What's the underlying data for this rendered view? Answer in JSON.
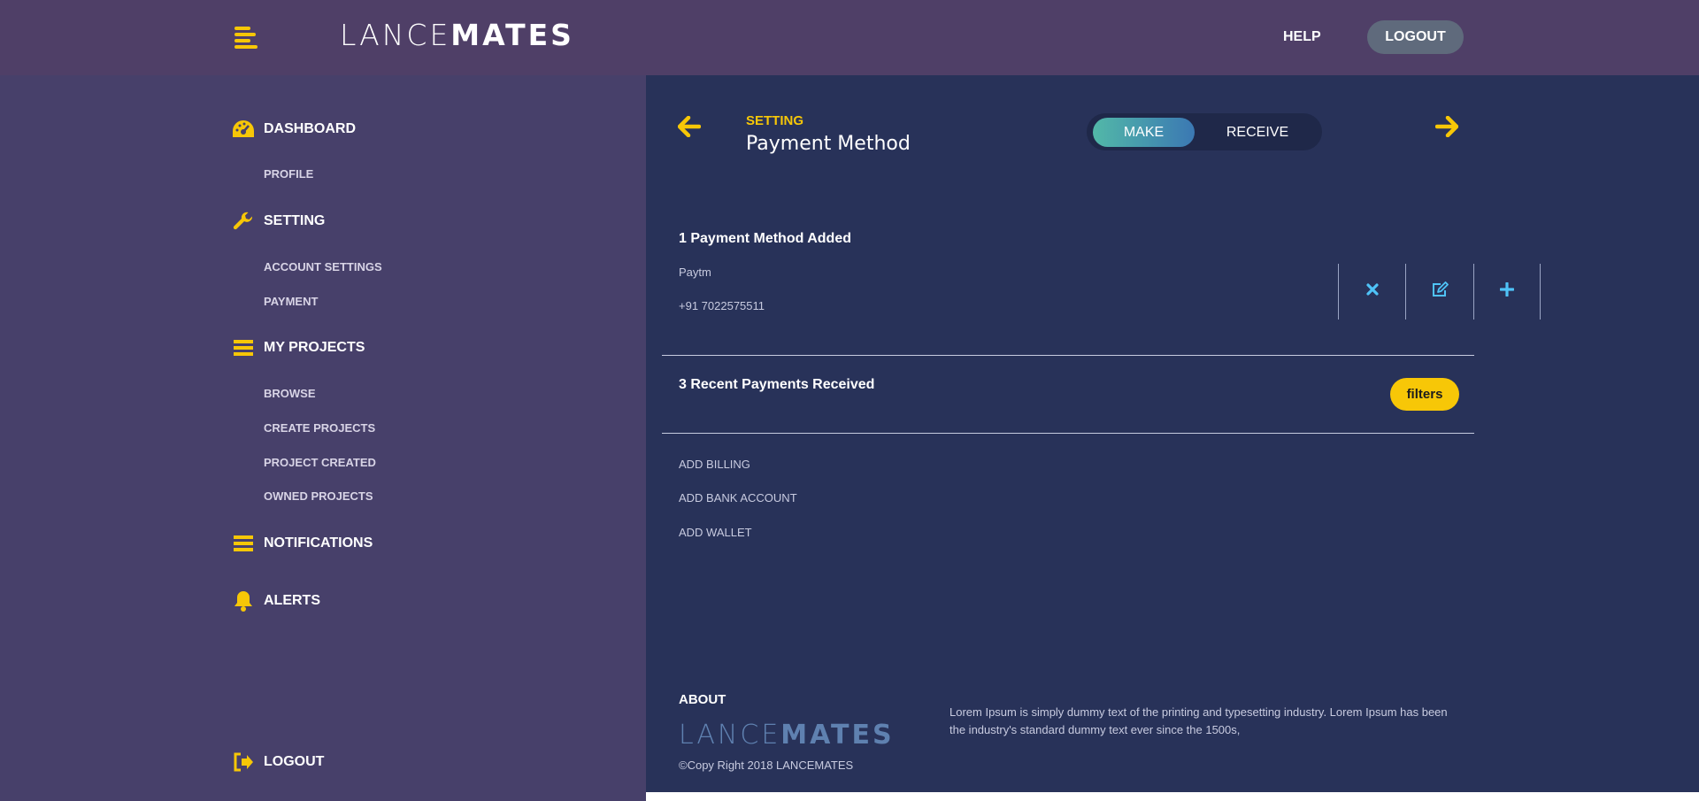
{
  "header": {
    "logo_light": "LANCE",
    "logo_bold": "MATES",
    "help_label": "HELP",
    "logout_label": "LOGOUT"
  },
  "sidebar": {
    "dashboard": "DASHBOARD",
    "profile": "PROFILE",
    "setting": "SETTING",
    "account_settings": "ACCOUNT SETTINGS",
    "payment": "PAYMENT",
    "my_projects": "MY PROJECTS",
    "browse": "BROWSE",
    "create_projects": "CREATE PROJECTS",
    "project_created": "PROJECT CREATED",
    "owned_projects": "OWNED PROJECTS",
    "notifications": "NOTIFICATIONS",
    "alerts": "ALERTS",
    "logout": "LOGOUT"
  },
  "main": {
    "breadcrumb": "SETTING",
    "title": "Payment Method",
    "toggle": {
      "make": "MAKE",
      "receive": "RECEIVE",
      "selected": "MAKE"
    },
    "methods_title": "1 Payment Method Added",
    "method_name": "Paytm",
    "method_number": "+91 7022575511",
    "recent_title": "3 Recent Payments Received",
    "filters_label": "filters",
    "links": [
      "ADD BILLING",
      "ADD BANK ACCOUNT",
      "ADD WALLET"
    ]
  },
  "footer": {
    "about_title": "ABOUT",
    "logo_light": "LANCE",
    "logo_bold": "MATES",
    "copyright": "©Copy Right 2018 LANCEMATES",
    "about_text": "Lorem Ipsum is simply dummy text of the printing and typesetting industry. Lorem Ipsum has been the industry's standard dummy text ever since the 1500s,"
  },
  "colors": {
    "accent": "#f7c707",
    "topbar": "#4f3f67",
    "sidebar": "#47406a",
    "main": "#283259",
    "icon_blue": "#4fc3f7"
  },
  "icons": [
    "menu-icon",
    "dashboard-icon",
    "wrench-icon",
    "list-icon",
    "bell-icon",
    "logout-icon",
    "arrow-left-icon",
    "arrow-right-icon",
    "close-icon",
    "edit-icon",
    "plus-icon"
  ]
}
